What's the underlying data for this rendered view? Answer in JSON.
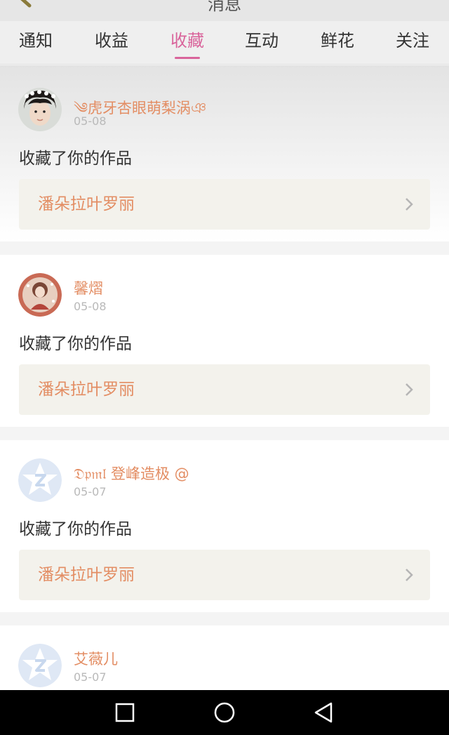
{
  "header": {
    "title": "消息"
  },
  "tabs": [
    {
      "label": "通知"
    },
    {
      "label": "收益"
    },
    {
      "label": "收藏",
      "active": true
    },
    {
      "label": "互动"
    },
    {
      "label": "鲜花"
    },
    {
      "label": "关注"
    }
  ],
  "messages": [
    {
      "username": "༄虎牙杏眼萌梨涡ঞ",
      "date": "05-08",
      "action": "收藏了你的作品",
      "work_title": "潘朵拉叶罗丽",
      "avatar": "photo-avatar"
    },
    {
      "username": "馨熠",
      "date": "05-08",
      "action": "收藏了你的作品",
      "work_title": "潘朵拉叶罗丽",
      "avatar": "illustration-avatar"
    },
    {
      "username": "𝔇𝔭𝔪𝔩 登峰造极 @",
      "date": "05-07",
      "action": "收藏了你的作品",
      "work_title": "潘朵拉叶罗丽",
      "avatar": "default-z-avatar"
    },
    {
      "username": "艾薇儿",
      "date": "05-07",
      "action": "",
      "work_title": "",
      "avatar": "default-z-avatar"
    }
  ],
  "colors": {
    "accent": "#d9649b",
    "username": "#e38d63",
    "work_title": "#e38d63"
  },
  "system_nav": {
    "buttons": [
      "recent-apps-icon",
      "home-icon",
      "back-icon"
    ]
  }
}
